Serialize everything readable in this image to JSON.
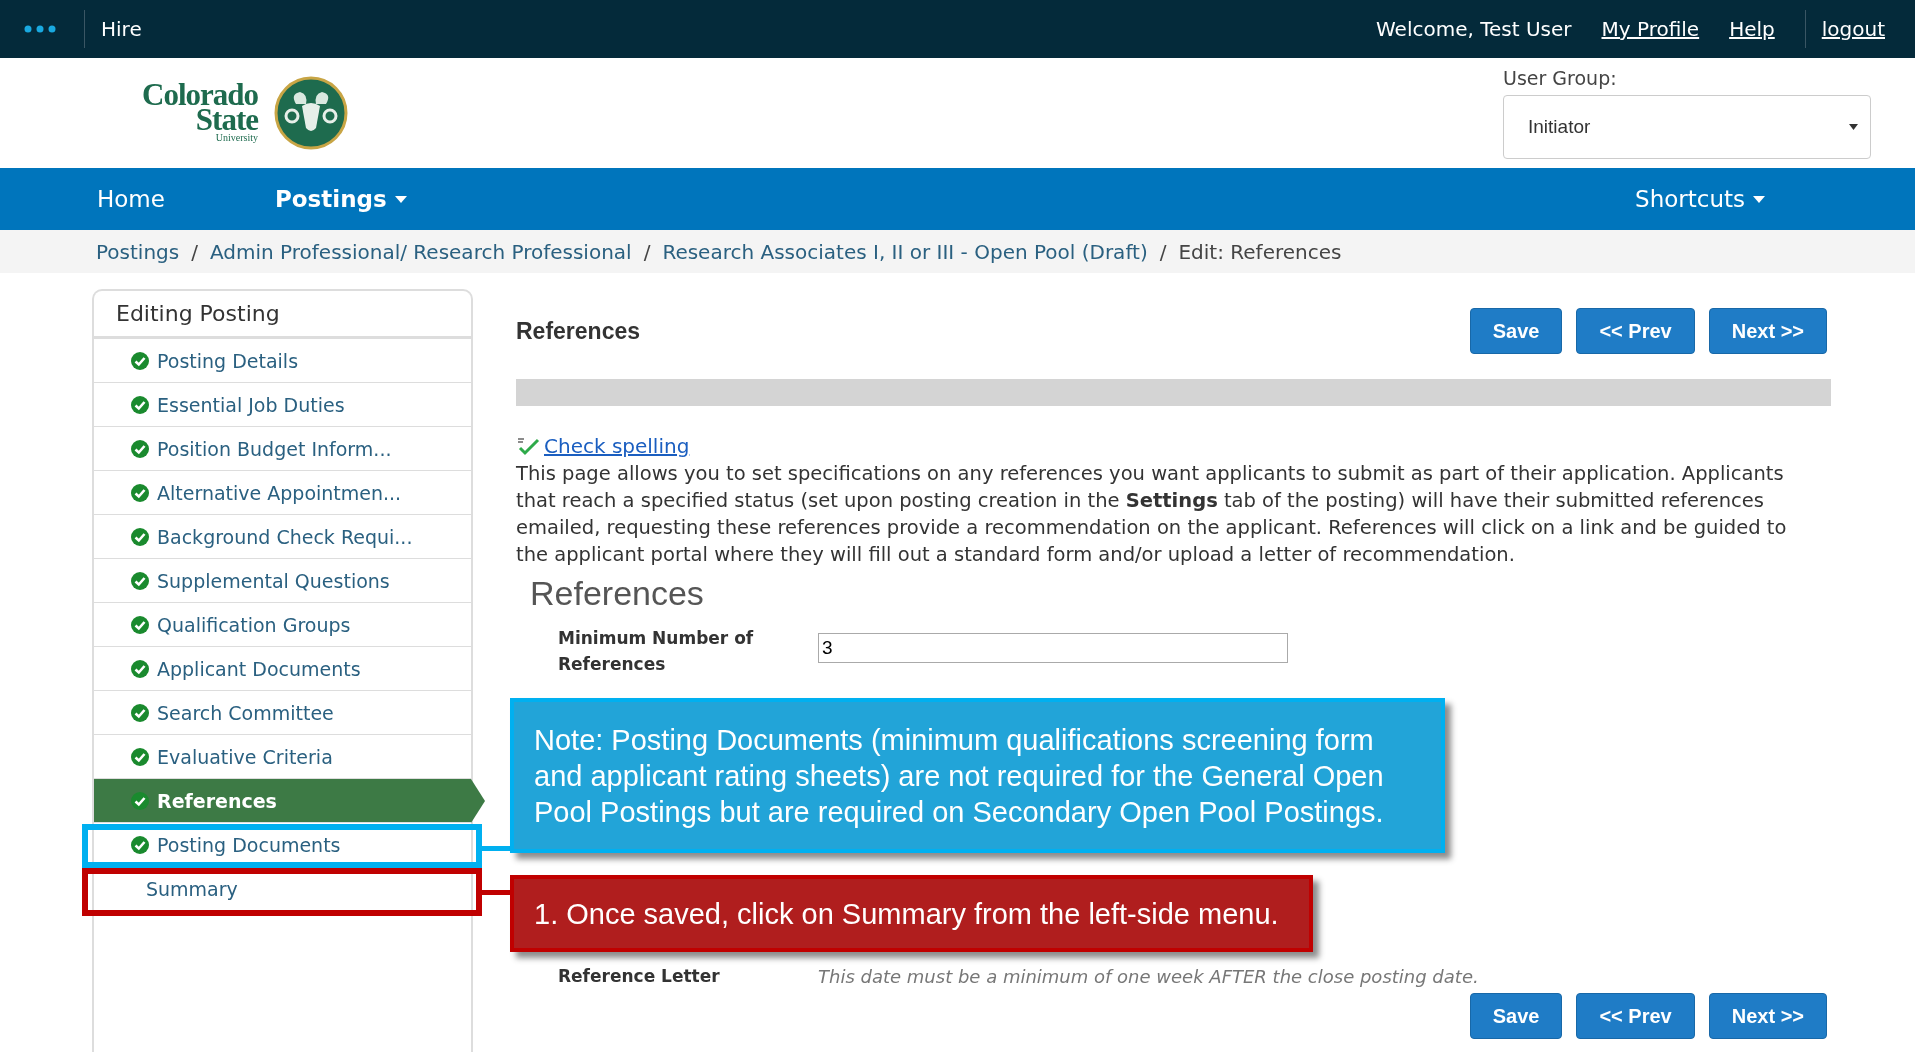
{
  "topbar": {
    "app_name": "Hire",
    "welcome": "Welcome, Test User",
    "links": [
      "My Profile",
      "Help",
      "logout"
    ]
  },
  "header": {
    "logo": {
      "line1": "Colorado",
      "line2": "State",
      "line3": "University"
    },
    "user_group": {
      "label": "User Group:",
      "value": "Initiator"
    }
  },
  "nav": {
    "items": [
      {
        "label": "Home",
        "selected": false,
        "dropdown": false
      },
      {
        "label": "Postings",
        "selected": true,
        "dropdown": true
      }
    ],
    "shortcuts": "Shortcuts"
  },
  "breadcrumb": {
    "separator": "/",
    "items": [
      {
        "label": "Postings",
        "current": false
      },
      {
        "label": "Admin Professional/ Research Professional",
        "current": false
      },
      {
        "label": "Research Associates I, II or III - Open Pool (Draft)",
        "current": false
      },
      {
        "label": "Edit: References",
        "current": true
      }
    ]
  },
  "sidebar": {
    "title": "Editing Posting",
    "items": [
      {
        "label": "Posting Details",
        "complete": true,
        "selected": false
      },
      {
        "label": "Essential Job Duties",
        "complete": true,
        "selected": false
      },
      {
        "label": "Position Budget Inform...",
        "complete": true,
        "selected": false
      },
      {
        "label": "Alternative Appointmen...",
        "complete": true,
        "selected": false
      },
      {
        "label": "Background Check Requi...",
        "complete": true,
        "selected": false
      },
      {
        "label": "Supplemental Questions",
        "complete": true,
        "selected": false
      },
      {
        "label": "Qualification Groups",
        "complete": true,
        "selected": false
      },
      {
        "label": "Applicant Documents",
        "complete": true,
        "selected": false
      },
      {
        "label": "Search Committee",
        "complete": true,
        "selected": false
      },
      {
        "label": "Evaluative Criteria",
        "complete": true,
        "selected": false
      },
      {
        "label": "References",
        "complete": true,
        "selected": true
      },
      {
        "label": "Posting Documents",
        "complete": true,
        "selected": false
      },
      {
        "label": "Summary",
        "complete": false,
        "selected": false
      }
    ]
  },
  "content": {
    "title": "References",
    "buttons": [
      "Save",
      "<< Prev",
      "Next >>"
    ],
    "spellcheck": "Check spelling",
    "description": "This page allows you to set specifications on any references you want applicants to submit as part of their application. Applicants that reach a specified status (set upon posting creation in the **Settings** tab of the posting) will have their submitted references emailed, requesting these references provide a recommendation on the applicant. References will click on a link and be guided to the applicant portal where they will fill out a standard form and/or upload a letter of recommendation.",
    "section_title": "References",
    "fields": [
      {
        "label": "Minimum Number of References",
        "value": "3"
      }
    ],
    "reference_letter": {
      "label": "Reference Letter",
      "hint": "This date must be a minimum of one week AFTER the close posting date."
    },
    "bottom_buttons": [
      "Save",
      "<< Prev",
      "Next >>"
    ]
  },
  "callouts": [
    {
      "kind": "note",
      "text": "Note: Posting Documents (minimum qualifications screening form and applicant rating sheets) are not required for the General Open Pool Postings but are required on Secondary Open Pool Postings."
    },
    {
      "kind": "step",
      "text": "1. Once saved, click on Summary from the left-side menu."
    }
  ]
}
